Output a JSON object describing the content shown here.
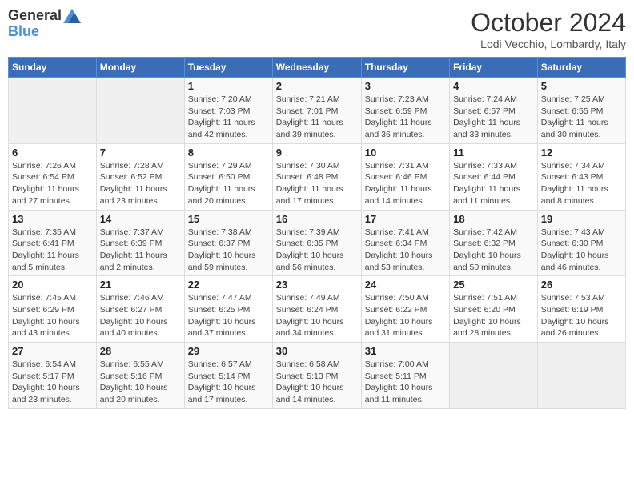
{
  "logo": {
    "general": "General",
    "blue": "Blue"
  },
  "title": "October 2024",
  "location": "Lodi Vecchio, Lombardy, Italy",
  "days_of_week": [
    "Sunday",
    "Monday",
    "Tuesday",
    "Wednesday",
    "Thursday",
    "Friday",
    "Saturday"
  ],
  "weeks": [
    [
      {
        "day": "",
        "info": ""
      },
      {
        "day": "",
        "info": ""
      },
      {
        "day": "1",
        "info": "Sunrise: 7:20 AM\nSunset: 7:03 PM\nDaylight: 11 hours and 42 minutes."
      },
      {
        "day": "2",
        "info": "Sunrise: 7:21 AM\nSunset: 7:01 PM\nDaylight: 11 hours and 39 minutes."
      },
      {
        "day": "3",
        "info": "Sunrise: 7:23 AM\nSunset: 6:59 PM\nDaylight: 11 hours and 36 minutes."
      },
      {
        "day": "4",
        "info": "Sunrise: 7:24 AM\nSunset: 6:57 PM\nDaylight: 11 hours and 33 minutes."
      },
      {
        "day": "5",
        "info": "Sunrise: 7:25 AM\nSunset: 6:55 PM\nDaylight: 11 hours and 30 minutes."
      }
    ],
    [
      {
        "day": "6",
        "info": "Sunrise: 7:26 AM\nSunset: 6:54 PM\nDaylight: 11 hours and 27 minutes."
      },
      {
        "day": "7",
        "info": "Sunrise: 7:28 AM\nSunset: 6:52 PM\nDaylight: 11 hours and 23 minutes."
      },
      {
        "day": "8",
        "info": "Sunrise: 7:29 AM\nSunset: 6:50 PM\nDaylight: 11 hours and 20 minutes."
      },
      {
        "day": "9",
        "info": "Sunrise: 7:30 AM\nSunset: 6:48 PM\nDaylight: 11 hours and 17 minutes."
      },
      {
        "day": "10",
        "info": "Sunrise: 7:31 AM\nSunset: 6:46 PM\nDaylight: 11 hours and 14 minutes."
      },
      {
        "day": "11",
        "info": "Sunrise: 7:33 AM\nSunset: 6:44 PM\nDaylight: 11 hours and 11 minutes."
      },
      {
        "day": "12",
        "info": "Sunrise: 7:34 AM\nSunset: 6:43 PM\nDaylight: 11 hours and 8 minutes."
      }
    ],
    [
      {
        "day": "13",
        "info": "Sunrise: 7:35 AM\nSunset: 6:41 PM\nDaylight: 11 hours and 5 minutes."
      },
      {
        "day": "14",
        "info": "Sunrise: 7:37 AM\nSunset: 6:39 PM\nDaylight: 11 hours and 2 minutes."
      },
      {
        "day": "15",
        "info": "Sunrise: 7:38 AM\nSunset: 6:37 PM\nDaylight: 10 hours and 59 minutes."
      },
      {
        "day": "16",
        "info": "Sunrise: 7:39 AM\nSunset: 6:35 PM\nDaylight: 10 hours and 56 minutes."
      },
      {
        "day": "17",
        "info": "Sunrise: 7:41 AM\nSunset: 6:34 PM\nDaylight: 10 hours and 53 minutes."
      },
      {
        "day": "18",
        "info": "Sunrise: 7:42 AM\nSunset: 6:32 PM\nDaylight: 10 hours and 50 minutes."
      },
      {
        "day": "19",
        "info": "Sunrise: 7:43 AM\nSunset: 6:30 PM\nDaylight: 10 hours and 46 minutes."
      }
    ],
    [
      {
        "day": "20",
        "info": "Sunrise: 7:45 AM\nSunset: 6:29 PM\nDaylight: 10 hours and 43 minutes."
      },
      {
        "day": "21",
        "info": "Sunrise: 7:46 AM\nSunset: 6:27 PM\nDaylight: 10 hours and 40 minutes."
      },
      {
        "day": "22",
        "info": "Sunrise: 7:47 AM\nSunset: 6:25 PM\nDaylight: 10 hours and 37 minutes."
      },
      {
        "day": "23",
        "info": "Sunrise: 7:49 AM\nSunset: 6:24 PM\nDaylight: 10 hours and 34 minutes."
      },
      {
        "day": "24",
        "info": "Sunrise: 7:50 AM\nSunset: 6:22 PM\nDaylight: 10 hours and 31 minutes."
      },
      {
        "day": "25",
        "info": "Sunrise: 7:51 AM\nSunset: 6:20 PM\nDaylight: 10 hours and 28 minutes."
      },
      {
        "day": "26",
        "info": "Sunrise: 7:53 AM\nSunset: 6:19 PM\nDaylight: 10 hours and 26 minutes."
      }
    ],
    [
      {
        "day": "27",
        "info": "Sunrise: 6:54 AM\nSunset: 5:17 PM\nDaylight: 10 hours and 23 minutes."
      },
      {
        "day": "28",
        "info": "Sunrise: 6:55 AM\nSunset: 5:16 PM\nDaylight: 10 hours and 20 minutes."
      },
      {
        "day": "29",
        "info": "Sunrise: 6:57 AM\nSunset: 5:14 PM\nDaylight: 10 hours and 17 minutes."
      },
      {
        "day": "30",
        "info": "Sunrise: 6:58 AM\nSunset: 5:13 PM\nDaylight: 10 hours and 14 minutes."
      },
      {
        "day": "31",
        "info": "Sunrise: 7:00 AM\nSunset: 5:11 PM\nDaylight: 10 hours and 11 minutes."
      },
      {
        "day": "",
        "info": ""
      },
      {
        "day": "",
        "info": ""
      }
    ]
  ]
}
